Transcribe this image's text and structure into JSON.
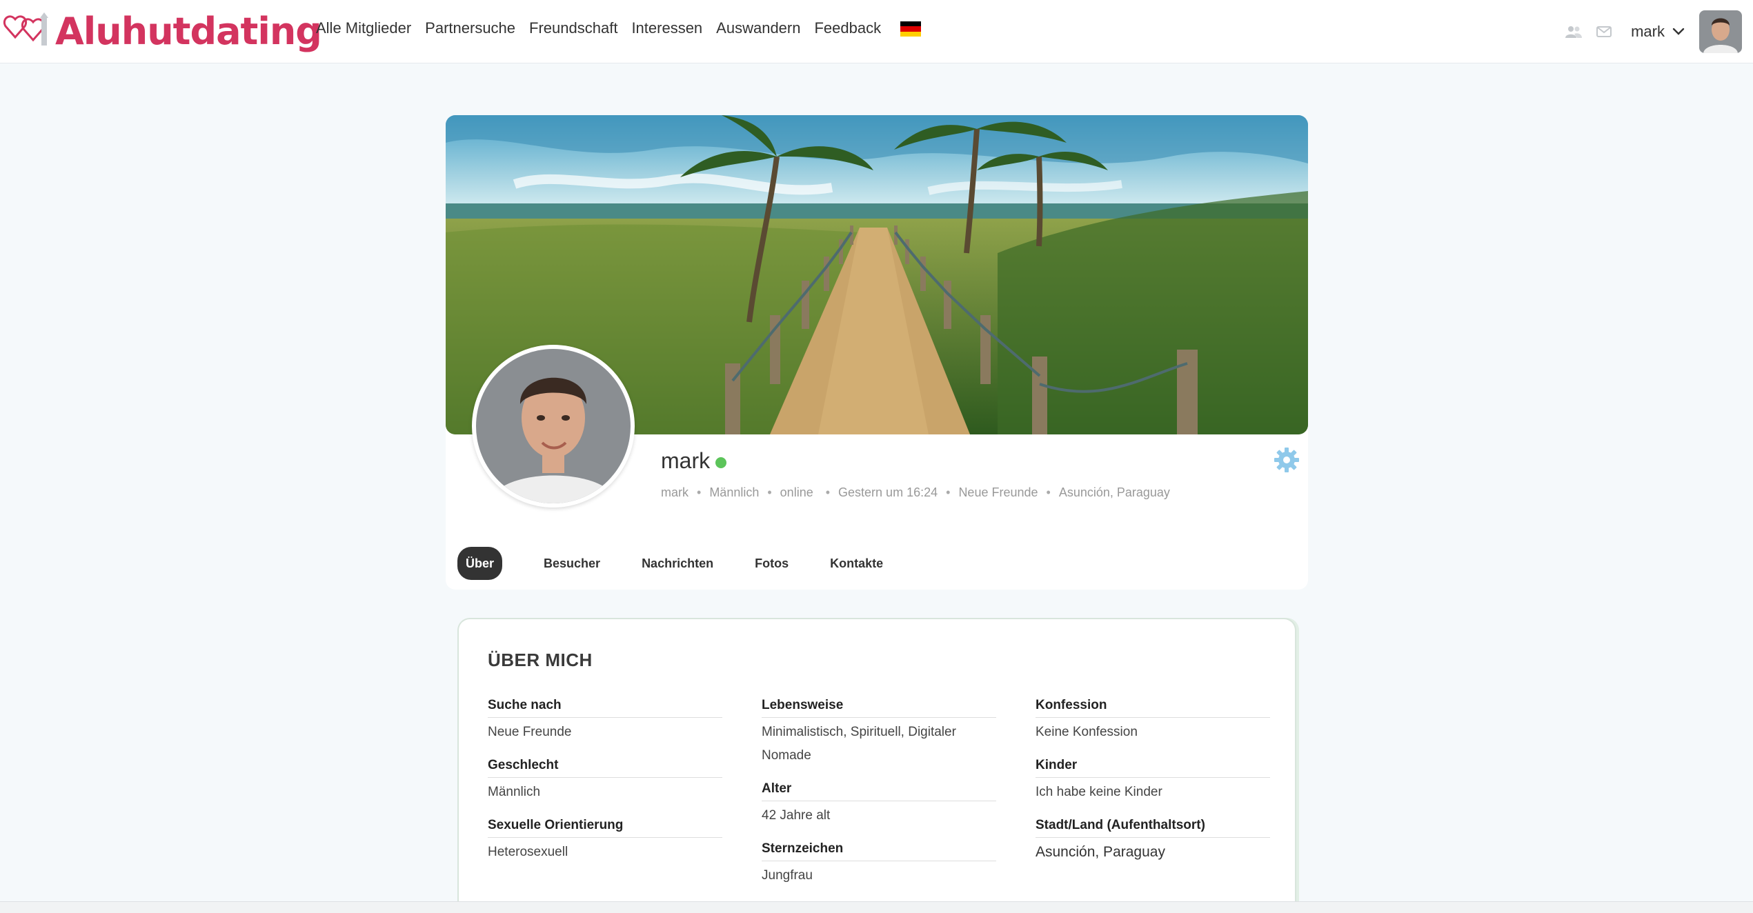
{
  "brand": {
    "name": "Aluhutdating",
    "color": "#d3345f"
  },
  "nav": {
    "items": [
      "Alle Mitglieder",
      "Partnersuche",
      "Freundschaft",
      "Interessen",
      "Auswandern",
      "Feedback"
    ],
    "flag_icon": "german-flag-icon"
  },
  "header_user": {
    "name": "mark",
    "friends_icon": "friends-icon",
    "mail_icon": "mail-icon",
    "dropdown_icon": "chevron-down-icon"
  },
  "profile": {
    "name": "mark",
    "online": true,
    "meta": [
      "mark",
      "Männlich",
      "online",
      "Gestern um 16:24",
      "Neue Freunde",
      "Asunción, Paraguay"
    ],
    "settings_icon": "gear-icon"
  },
  "tabs": [
    {
      "label": "Über",
      "active": true
    },
    {
      "label": "Besucher",
      "active": false
    },
    {
      "label": "Nachrichten",
      "active": false
    },
    {
      "label": "Fotos",
      "active": false
    },
    {
      "label": "Kontakte",
      "active": false
    }
  ],
  "about": {
    "title": "ÜBER MICH",
    "columns": [
      [
        {
          "label": "Suche nach",
          "value": "Neue Freunde"
        },
        {
          "label": "Geschlecht",
          "value": "Männlich"
        },
        {
          "label": "Sexuelle Orientierung",
          "value": "Heterosexuell"
        }
      ],
      [
        {
          "label": "Lebensweise",
          "value": "Minimalistisch, Spirituell, Digitaler Nomade"
        },
        {
          "label": "Alter",
          "value": "42 Jahre alt"
        },
        {
          "label": "Sternzeichen",
          "value": "Jungfrau"
        }
      ],
      [
        {
          "label": "Konfession",
          "value": "Keine Konfession"
        },
        {
          "label": "Kinder",
          "value": "Ich habe keine Kinder"
        },
        {
          "label": "Stadt/Land (Aufenthaltsort)",
          "value": "Asunción, Paraguay"
        }
      ]
    ]
  },
  "colors": {
    "online": "#5cc45a",
    "settings": "#8fc9ea",
    "active_tab": "#333333"
  }
}
